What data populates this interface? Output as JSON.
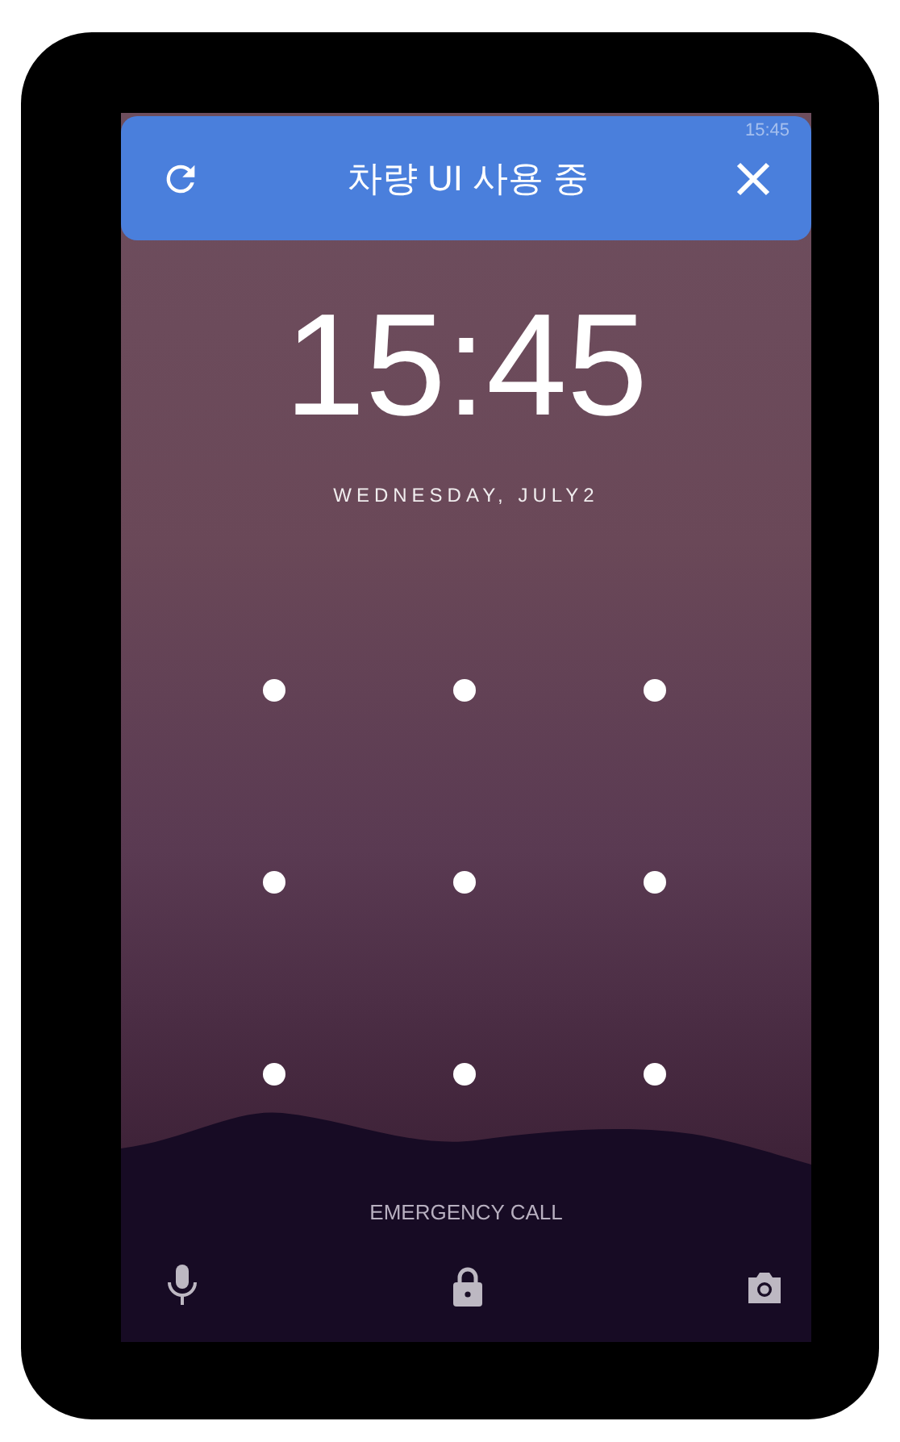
{
  "status_bar": {
    "time": "15:45"
  },
  "banner": {
    "title": "차량 UI 사용 중"
  },
  "lock_screen": {
    "time": "15:45",
    "date": "WEDNESDAY, JULY2",
    "emergency": "EMERGENCY CALL"
  }
}
